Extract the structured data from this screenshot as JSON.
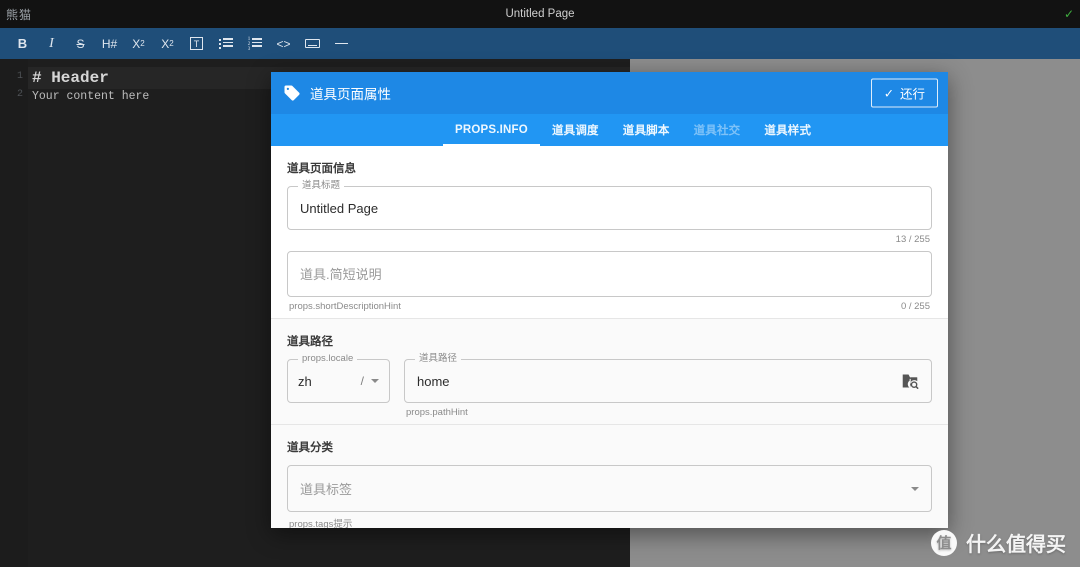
{
  "window": {
    "app_name": "熊猫",
    "title": "Untitled Page",
    "status_icon": "check-icon"
  },
  "toolbar": {
    "items": [
      {
        "name": "bold",
        "glyph": "B"
      },
      {
        "name": "italic",
        "glyph": "I"
      },
      {
        "name": "strikethrough",
        "glyph": "S"
      },
      {
        "name": "heading",
        "glyph": "H#"
      },
      {
        "name": "subscript",
        "glyph": "X2"
      },
      {
        "name": "superscript",
        "glyph": "X2"
      },
      {
        "name": "text-box",
        "glyph": "T"
      },
      {
        "name": "bullet-list",
        "glyph": "list"
      },
      {
        "name": "numbered-list",
        "glyph": "list"
      },
      {
        "name": "code",
        "glyph": "<>"
      },
      {
        "name": "keyboard",
        "glyph": "keyboard"
      },
      {
        "name": "horizontal-rule",
        "glyph": "-"
      }
    ]
  },
  "editor": {
    "line_numbers": [
      "1",
      "2"
    ],
    "line1": "# Header",
    "line2": "Your content here"
  },
  "dialog": {
    "title": "道具页面属性",
    "title_icon": "tag-icon",
    "confirm_label": "还行",
    "confirm_icon": "check-icon",
    "tabs": [
      {
        "label": "PROPS.INFO",
        "active": true,
        "disabled": false
      },
      {
        "label": "道具调度",
        "active": false,
        "disabled": false
      },
      {
        "label": "道具脚本",
        "active": false,
        "disabled": false
      },
      {
        "label": "道具社交",
        "active": false,
        "disabled": true
      },
      {
        "label": "道具样式",
        "active": false,
        "disabled": false
      }
    ],
    "sections": {
      "info": {
        "title": "道具页面信息",
        "title_field": {
          "label": "道具标题",
          "value": "Untitled Page",
          "counter": "13 / 255"
        },
        "description_field": {
          "placeholder": "道具.简短说明",
          "hint": "props.shortDescriptionHint",
          "counter": "0 / 255"
        }
      },
      "path": {
        "title": "道具路径",
        "locale_field": {
          "label": "props.locale",
          "value": "zh",
          "separator": "/"
        },
        "path_field": {
          "label": "道具路径",
          "value": "home",
          "hint": "props.pathHint",
          "browse_icon": "folder-search-icon"
        }
      },
      "category": {
        "title": "道具分类",
        "tags_field": {
          "placeholder": "道具标签",
          "hint": "props.tags提示"
        }
      }
    }
  },
  "watermark": {
    "logo": "值",
    "text": "什么值得买"
  },
  "colors": {
    "accent": "#2196f3",
    "header": "#1e88e5",
    "toolbar": "#1f4e79",
    "editor_bg": "#1e1e1e",
    "preview_bg": "#8d8d8d"
  }
}
